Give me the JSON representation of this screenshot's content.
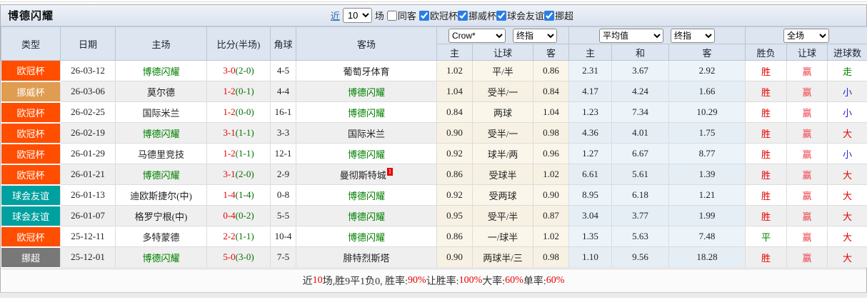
{
  "toolbar": {
    "title": "博德闪耀",
    "recent_label": "近",
    "recent_value": "10",
    "recent_suffix": "场",
    "same_away_label": "同客",
    "same_away_checked": false,
    "league_filters": [
      {
        "label": "欧冠杯",
        "checked": true
      },
      {
        "label": "挪威杯",
        "checked": true
      },
      {
        "label": "球会友谊",
        "checked": true
      },
      {
        "label": "挪超",
        "checked": true
      }
    ]
  },
  "header": {
    "cols": [
      "类型",
      "日期",
      "主场",
      "比分(半场)",
      "角球",
      "客场"
    ],
    "groups": {
      "handicap": {
        "select1": "Crow*",
        "select2": "终指",
        "sub": [
          "主",
          "让球",
          "客"
        ]
      },
      "average": {
        "select1": "平均值",
        "select2": "终指",
        "sub": [
          "主",
          "和",
          "客"
        ]
      },
      "result": {
        "select1": "全场",
        "sub": [
          "胜负",
          "让球",
          "进球数"
        ]
      }
    }
  },
  "league_colors": {
    "欧冠杯": "#ff4e00",
    "挪威杯": "#e09c50",
    "球会友谊": "#00a0a0",
    "挪超": "#787878"
  },
  "outcome_colors": {
    "胜": "#e60000",
    "平": "#008000",
    "负": "#2222d5",
    "赢": "#f0444c",
    "走": "#008000",
    "大": "#e60000",
    "小": "#2222d5"
  },
  "rows": [
    {
      "type": "欧冠杯",
      "date": "26-03-12",
      "home": "博德闪耀",
      "home_self": true,
      "score": "3-0",
      "half": "(2-0)",
      "corner": "4-5",
      "away": "葡萄牙体育",
      "away_self": false,
      "h_home": "1.02",
      "handicap": "平/半",
      "h_away": "0.86",
      "avg_home": "2.31",
      "avg_draw": "3.67",
      "avg_away": "2.92",
      "res_wdl": "胜",
      "res_handicap": "赢",
      "res_goals": "走"
    },
    {
      "type": "挪威杯",
      "date": "26-03-06",
      "home": "莫尔德",
      "home_self": false,
      "score": "1-2",
      "half": "(0-1)",
      "corner": "4-4",
      "away": "博德闪耀",
      "away_self": true,
      "h_home": "1.04",
      "handicap": "受半/一",
      "h_away": "0.84",
      "avg_home": "4.17",
      "avg_draw": "4.24",
      "avg_away": "1.66",
      "res_wdl": "胜",
      "res_handicap": "赢",
      "res_goals": "小"
    },
    {
      "type": "欧冠杯",
      "date": "26-02-25",
      "home": "国际米兰",
      "home_self": false,
      "score": "1-2",
      "half": "(0-0)",
      "corner": "16-1",
      "away": "博德闪耀",
      "away_self": true,
      "h_home": "0.84",
      "handicap": "两球",
      "h_away": "1.04",
      "avg_home": "1.23",
      "avg_draw": "7.34",
      "avg_away": "10.29",
      "res_wdl": "胜",
      "res_handicap": "赢",
      "res_goals": "小"
    },
    {
      "type": "欧冠杯",
      "date": "26-02-19",
      "home": "博德闪耀",
      "home_self": true,
      "score": "3-1",
      "half": "(1-1)",
      "corner": "3-3",
      "away": "国际米兰",
      "away_self": false,
      "h_home": "0.90",
      "handicap": "受半/一",
      "h_away": "0.98",
      "avg_home": "4.36",
      "avg_draw": "4.01",
      "avg_away": "1.75",
      "res_wdl": "胜",
      "res_handicap": "赢",
      "res_goals": "大"
    },
    {
      "type": "欧冠杯",
      "date": "26-01-29",
      "home": "马德里竞技",
      "home_self": false,
      "score": "1-2",
      "half": "(1-1)",
      "corner": "12-1",
      "away": "博德闪耀",
      "away_self": true,
      "h_home": "0.92",
      "handicap": "球半/两",
      "h_away": "0.96",
      "avg_home": "1.27",
      "avg_draw": "6.67",
      "avg_away": "8.77",
      "res_wdl": "胜",
      "res_handicap": "赢",
      "res_goals": "小"
    },
    {
      "type": "欧冠杯",
      "date": "26-01-21",
      "home": "博德闪耀",
      "home_self": true,
      "score": "3-1",
      "half": "(2-0)",
      "corner": "2-9",
      "away": "曼彻斯特城",
      "away_self": false,
      "away_sup": "1",
      "h_home": "0.86",
      "handicap": "受球半",
      "h_away": "1.02",
      "avg_home": "6.61",
      "avg_draw": "5.61",
      "avg_away": "1.39",
      "res_wdl": "胜",
      "res_handicap": "赢",
      "res_goals": "大"
    },
    {
      "type": "球会友谊",
      "date": "26-01-13",
      "home": "迪欧斯捷尔(中)",
      "home_self": false,
      "score": "1-4",
      "half": "(1-4)",
      "corner": "0-8",
      "away": "博德闪耀",
      "away_self": true,
      "h_home": "0.92",
      "handicap": "受两球",
      "h_away": "0.90",
      "avg_home": "8.95",
      "avg_draw": "6.18",
      "avg_away": "1.21",
      "res_wdl": "胜",
      "res_handicap": "赢",
      "res_goals": "大"
    },
    {
      "type": "球会友谊",
      "date": "26-01-07",
      "home": "格罗宁根(中)",
      "home_self": false,
      "score": "0-4",
      "half": "(0-2)",
      "corner": "5-5",
      "away": "博德闪耀",
      "away_self": true,
      "h_home": "0.95",
      "handicap": "受平/半",
      "h_away": "0.87",
      "avg_home": "3.04",
      "avg_draw": "3.77",
      "avg_away": "1.99",
      "res_wdl": "胜",
      "res_handicap": "赢",
      "res_goals": "大"
    },
    {
      "type": "欧冠杯",
      "date": "25-12-11",
      "home": "多特蒙德",
      "home_self": false,
      "score": "2-2",
      "half": "(1-1)",
      "corner": "10-4",
      "away": "博德闪耀",
      "away_self": true,
      "h_home": "0.86",
      "handicap": "一/球半",
      "h_away": "1.02",
      "avg_home": "1.35",
      "avg_draw": "5.63",
      "avg_away": "7.48",
      "res_wdl": "平",
      "res_handicap": "赢",
      "res_goals": "大"
    },
    {
      "type": "挪超",
      "date": "25-12-01",
      "home": "博德闪耀",
      "home_self": true,
      "score": "5-0",
      "half": "(3-0)",
      "corner": "7-5",
      "away": "腓特烈斯塔",
      "away_self": false,
      "h_home": "0.90",
      "handicap": "两球半/三",
      "h_away": "0.98",
      "avg_home": "1.10",
      "avg_draw": "9.56",
      "avg_away": "18.28",
      "res_wdl": "胜",
      "res_handicap": "赢",
      "res_goals": "大"
    }
  ],
  "footer": {
    "segments": [
      {
        "text": "近",
        "hl": false
      },
      {
        "text": "10",
        "hl": true
      },
      {
        "text": "场,胜9平1负0, 胜率:",
        "hl": false
      },
      {
        "text": "90%",
        "hl": true
      },
      {
        "text": " 让胜率:",
        "hl": false
      },
      {
        "text": "100%",
        "hl": true
      },
      {
        "text": " 大率:",
        "hl": false
      },
      {
        "text": "60%",
        "hl": true
      },
      {
        "text": " 单率:",
        "hl": false
      },
      {
        "text": "60%",
        "hl": true
      }
    ]
  }
}
